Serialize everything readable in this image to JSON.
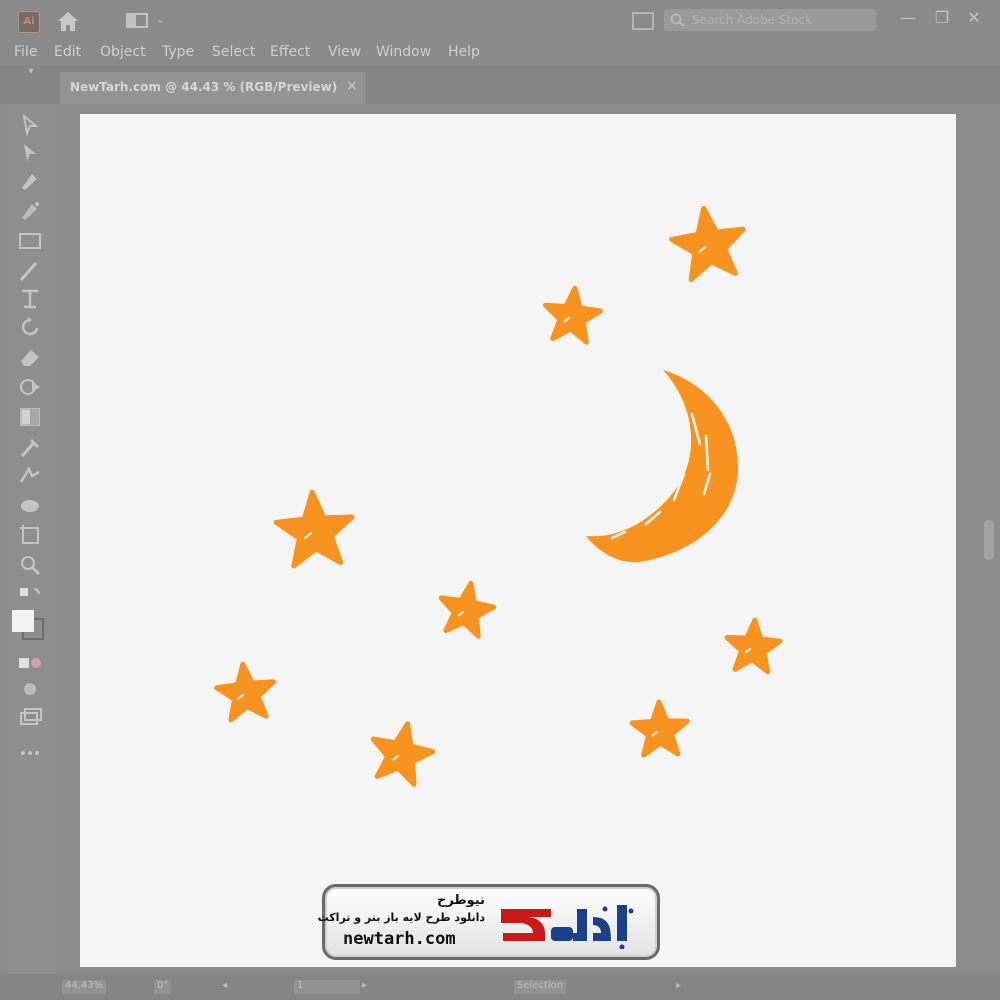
{
  "app": {
    "logo_text": "Ai",
    "search": {
      "placeholder": "Search Adobe Stock"
    },
    "window_controls": {
      "minimize": "—",
      "restore": "❐",
      "close": "✕"
    }
  },
  "menu": [
    "File",
    "Edit",
    "Object",
    "Type",
    "Select",
    "Effect",
    "View",
    "Window",
    "Help"
  ],
  "document": {
    "tab_title": "NewTarh.com @ 44.43 % (RGB/Preview)",
    "close_glyph": "×"
  },
  "statusbar": {
    "zoom": "44.43%",
    "rotation": "0°",
    "artboard_number": "1",
    "current_tool": "Selection"
  },
  "colors": {
    "accent_orange": "#f7931e",
    "ui_gray": "#8c8c8c",
    "artboard": "#f5f5f5"
  },
  "icons": [
    "selection-icon",
    "direct-selection-icon",
    "pen-icon",
    "curvature-icon",
    "rectangle-icon",
    "brush-icon",
    "type-icon",
    "rotate-icon",
    "eraser-icon",
    "shape-builder-icon",
    "gradient-icon",
    "eyedropper-icon",
    "blend-icon",
    "symbol-sprayer-icon",
    "artboard-icon",
    "zoom-icon"
  ],
  "watermark": {
    "name_fa": "نیوطرح",
    "tagline_fa": "دانلود طرح لایه باز بنر و تراکت",
    "domain": "newtarh.com",
    "logo_text": "نیوطرح"
  }
}
